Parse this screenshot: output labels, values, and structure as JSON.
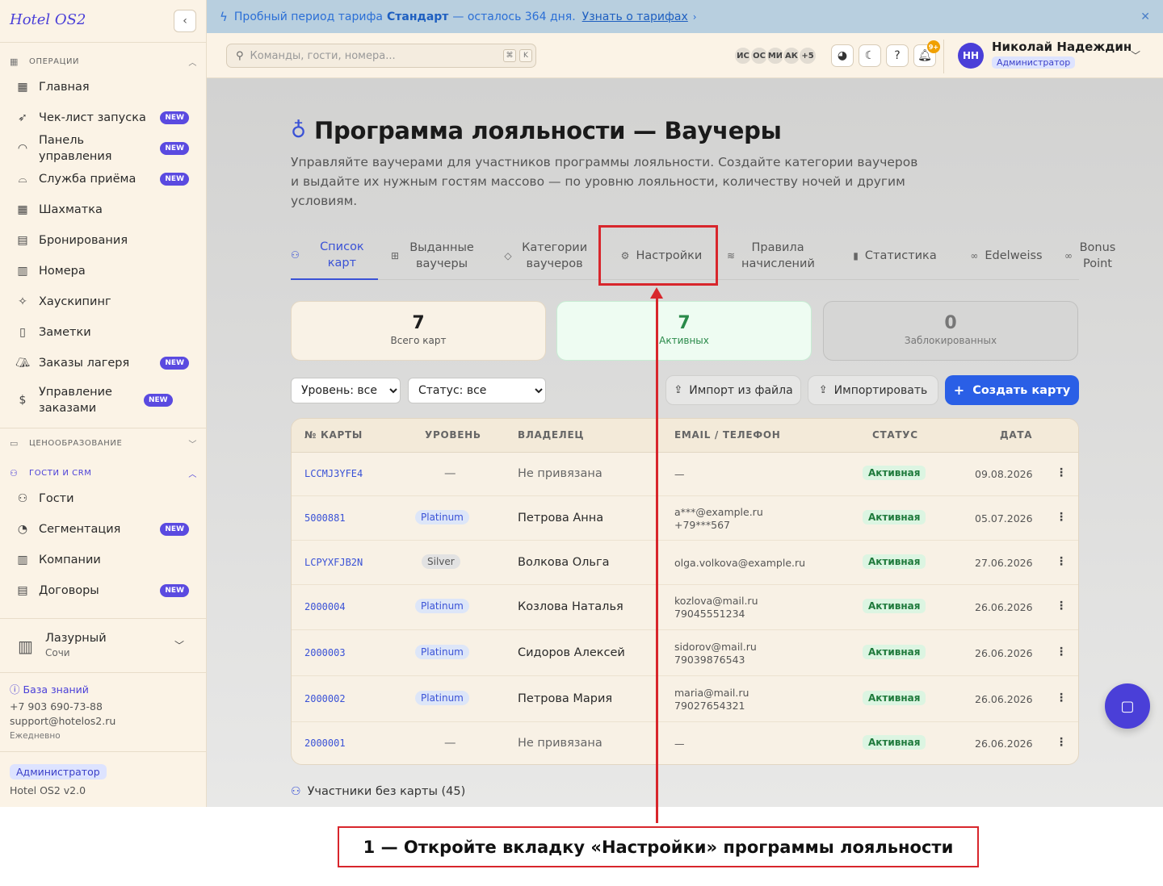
{
  "sidebar": {
    "brand": "Hotel OS2",
    "section_ops": "ОПЕРАЦИИ",
    "items_ops": [
      {
        "label": "Главная",
        "icon": "dashboard-icon",
        "badge": ""
      },
      {
        "label": "Чек-лист запуска",
        "icon": "rocket-icon",
        "badge": "NEW"
      },
      {
        "label": "Панель управления",
        "icon": "gauge-icon",
        "badge": "NEW"
      },
      {
        "label": "Служба приёма",
        "icon": "bell-service-icon",
        "badge": "NEW"
      },
      {
        "label": "Шахматка",
        "icon": "grid-icon",
        "badge": ""
      },
      {
        "label": "Бронирования",
        "icon": "clipboard-icon",
        "badge": ""
      },
      {
        "label": "Номера",
        "icon": "building-icon",
        "badge": ""
      },
      {
        "label": "Хаускипинг",
        "icon": "sparkles-icon",
        "badge": ""
      },
      {
        "label": "Заметки",
        "icon": "note-icon",
        "badge": ""
      },
      {
        "label": "Заказы лагеря",
        "icon": "tent-icon",
        "badge": "NEW"
      },
      {
        "label": "Управление заказами",
        "icon": "dollar-icon",
        "badge": "NEW"
      }
    ],
    "section_pricing": "ЦЕНООБРАЗОВАНИЕ",
    "section_crm": "ГОСТИ И CRM",
    "items_crm": [
      {
        "label": "Гости",
        "icon": "users-icon",
        "badge": ""
      },
      {
        "label": "Сегментация",
        "icon": "pie-icon",
        "badge": "NEW"
      },
      {
        "label": "Компании",
        "icon": "office-icon",
        "badge": ""
      },
      {
        "label": "Договоры",
        "icon": "document-icon",
        "badge": "NEW"
      }
    ],
    "hotel": {
      "name": "Лазурный",
      "city": "Сочи"
    },
    "knowledge_base": "База знаний",
    "phone": "+7 903 690-73-88",
    "email": "support@hotelos2.ru",
    "schedule": "Ежедневно",
    "role": "Администратор",
    "version": "Hotel OS2 v2.0"
  },
  "banner": {
    "text_before": "Пробный период тарифа",
    "plan": "Стандарт",
    "text_after": "— осталось 364 дня.",
    "link": "Узнать о тарифах"
  },
  "header": {
    "search_placeholder": "Команды, гости, номера...",
    "kbd1": "⌘",
    "kbd2": "K",
    "avatars": [
      "ИС",
      "ОС",
      "МИ",
      "АК",
      "+5"
    ],
    "notif_count": "9+",
    "user_initials": "НН",
    "user_name": "Николай Надеждин",
    "user_role": "Администратор"
  },
  "page": {
    "title": "Программа лояльности — Ваучеры",
    "subtitle": "Управляйте ваучерами для участников программы лояльности. Создайте категории ваучеров и выдайте их нужным гостям массово — по уровню лояльности, количеству ночей и другим условиям."
  },
  "tabs": [
    {
      "label": "Список карт",
      "icon": "users-icon"
    },
    {
      "label": "Выданные ваучеры",
      "icon": "gift-icon"
    },
    {
      "label": "Категории ваучеров",
      "icon": "tag-icon"
    },
    {
      "label": "Настройки",
      "icon": "gear-icon"
    },
    {
      "label": "Правила начислений",
      "icon": "layers-icon"
    },
    {
      "label": "Статистика",
      "icon": "bar-chart-icon"
    },
    {
      "label": "Edelweiss",
      "icon": "link-icon"
    },
    {
      "label": "Bonus Point",
      "icon": "link-icon"
    }
  ],
  "stats": [
    {
      "value": "7",
      "label": "Всего карт"
    },
    {
      "value": "7",
      "label": "Активных"
    },
    {
      "value": "0",
      "label": "Заблокированных"
    }
  ],
  "filters": {
    "level": "Уровень: все",
    "status": "Статус: все"
  },
  "actions": {
    "import_file": "Импорт из файла",
    "import": "Импортировать",
    "create": "Создать карту"
  },
  "table": {
    "headers": {
      "card": "№ КАРТЫ",
      "level": "УРОВЕНЬ",
      "owner": "ВЛАДЕЛЕЦ",
      "contact": "EMAIL / ТЕЛЕФОН",
      "status": "СТАТУС",
      "date": "ДАТА"
    },
    "rows": [
      {
        "card": "LCCMJ3YFE4",
        "level": "—",
        "owner": "Не привязана",
        "email": "—",
        "phone": "",
        "status": "Активная",
        "date": "09.08.2026"
      },
      {
        "card": "5000881",
        "level": "Platinum",
        "owner": "Петрова Анна",
        "email": "a***@example.ru",
        "phone": "+79***567",
        "status": "Активная",
        "date": "05.07.2026"
      },
      {
        "card": "LCPYXFJB2N",
        "level": "Silver",
        "owner": "Волкова Ольга",
        "email": "olga.volkova@example.ru",
        "phone": "",
        "status": "Активная",
        "date": "27.06.2026"
      },
      {
        "card": "2000004",
        "level": "Platinum",
        "owner": "Козлова Наталья",
        "email": "kozlova@mail.ru",
        "phone": "79045551234",
        "status": "Активная",
        "date": "26.06.2026"
      },
      {
        "card": "2000003",
        "level": "Platinum",
        "owner": "Сидоров Алексей",
        "email": "sidorov@mail.ru",
        "phone": "79039876543",
        "status": "Активная",
        "date": "26.06.2026"
      },
      {
        "card": "2000002",
        "level": "Platinum",
        "owner": "Петрова Мария",
        "email": "maria@mail.ru",
        "phone": "79027654321",
        "status": "Активная",
        "date": "26.06.2026"
      },
      {
        "card": "2000001",
        "level": "—",
        "owner": "Не привязана",
        "email": "—",
        "phone": "",
        "status": "Активная",
        "date": "26.06.2026"
      }
    ]
  },
  "members_without_card": "Участники без карты (45)",
  "annotation": {
    "caption": "1 — Откройте вкладку «Настройки» программы лояльности",
    "color": "#d8262c"
  }
}
